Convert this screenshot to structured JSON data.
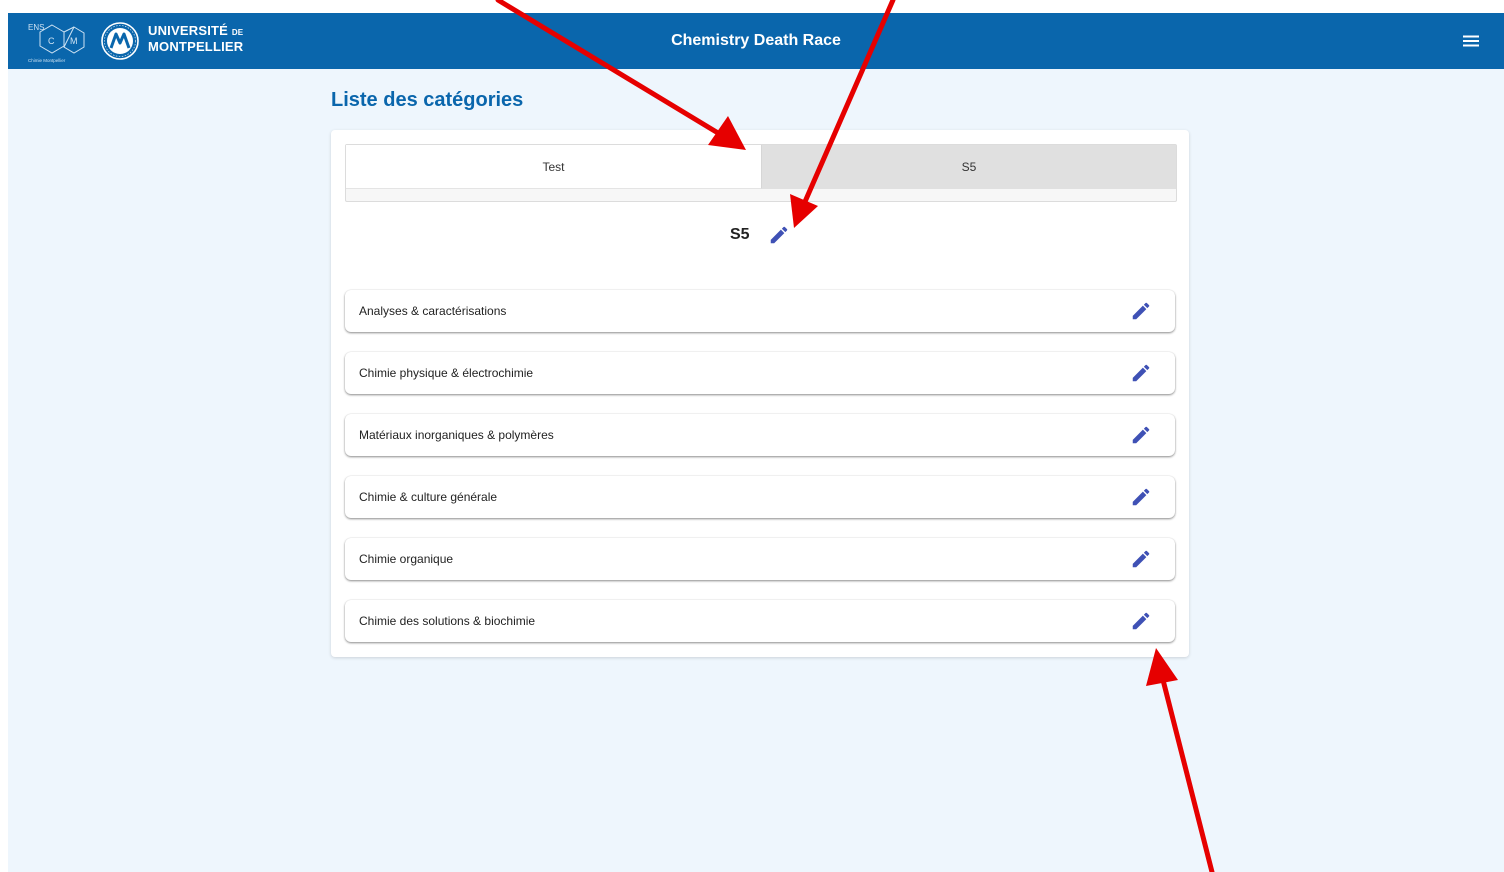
{
  "header": {
    "title": "Chemistry Death Race",
    "ens_logo": {
      "top": "ENS",
      "left": "C",
      "right": "M",
      "caption": "Chimie Montpellier"
    },
    "university_logo": {
      "line1": "UNIVERSITÉ",
      "small": "DE",
      "line2": "MONTPELLIER"
    },
    "menu_icon": "hamburger-menu-icon"
  },
  "page": {
    "title": "Liste des catégories"
  },
  "tabs": [
    {
      "label": "Test",
      "selected": false
    },
    {
      "label": "S5",
      "selected": true
    }
  ],
  "selected_category": {
    "name": "S5",
    "edit_icon": "pencil-icon"
  },
  "subcategories": [
    {
      "label": "Analyses & caractérisations"
    },
    {
      "label": "Chimie physique & électrochimie"
    },
    {
      "label": "Matériaux inorganiques & polymères"
    },
    {
      "label": "Chimie & culture générale"
    },
    {
      "label": "Chimie organique"
    },
    {
      "label": "Chimie des solutions & biochimie"
    }
  ],
  "colors": {
    "header_bg": "#0a66ac",
    "page_bg": "#eef6fd",
    "edit_icon": "#3f51b5",
    "annotation_arrow": "#e60000"
  }
}
